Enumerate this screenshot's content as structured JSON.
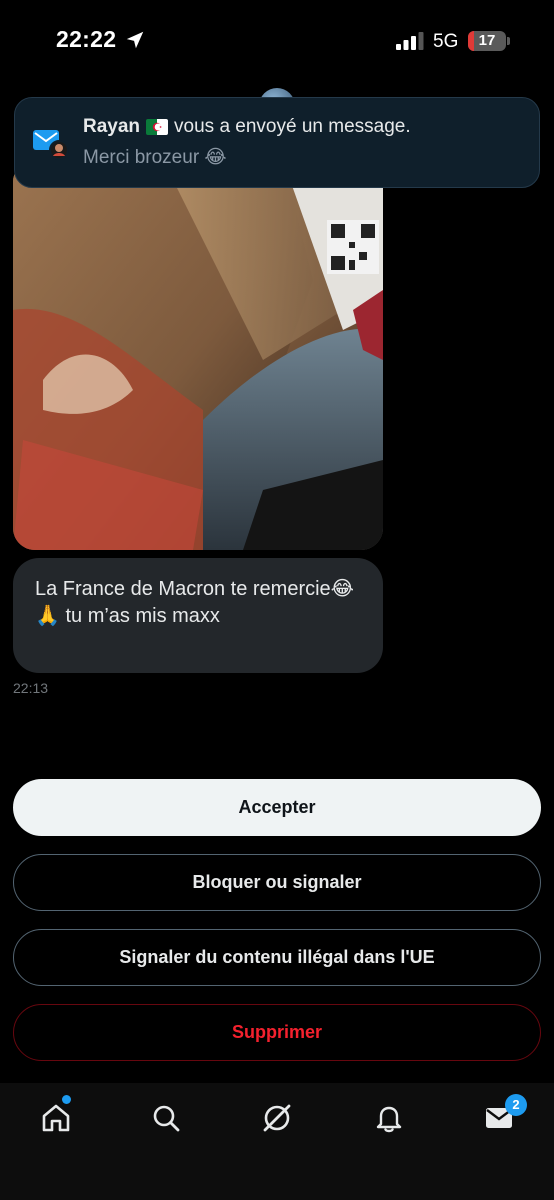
{
  "status_bar": {
    "time": "22:22",
    "network": "5G",
    "battery": "17",
    "battery_level": 0.17,
    "icons": [
      "location-arrow-icon",
      "signal-icon"
    ]
  },
  "notification": {
    "sender": "Rayan",
    "sender_flag": "algeria-flag",
    "action_text": "vous a envoyé un message.",
    "preview": "Merci brozeur 😂"
  },
  "conversation": {
    "message_text": "La France de Macron te remercie😂🙏 tu m’as mis maxx",
    "timestamp": "22:13"
  },
  "actions": {
    "accept": "Accepter",
    "block_report": "Bloquer ou signaler",
    "report_illegal": "Signaler du contenu illégal dans l'UE",
    "delete": "Supprimer"
  },
  "bottom_nav": {
    "items": [
      "home-icon",
      "search-icon",
      "grok-icon",
      "notifications-icon",
      "messages-icon"
    ],
    "messages_badge": "2"
  },
  "colors": {
    "accent": "#1d9bf0",
    "danger": "#f4212e",
    "bubble": "#23272b",
    "background": "#000000"
  }
}
